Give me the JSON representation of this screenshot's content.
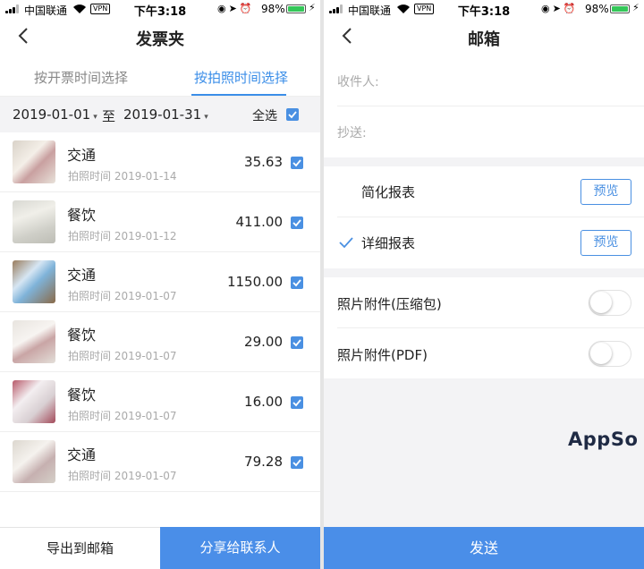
{
  "status_bar": {
    "carrier": "中国联通",
    "vpn": "VPN",
    "time": "下午3:18",
    "battery_pct": "98%",
    "battery_level": 0.98
  },
  "left": {
    "title": "发票夹",
    "tabs": [
      {
        "label": "按开票时间选择",
        "active": false
      },
      {
        "label": "按拍照时间选择",
        "active": true
      }
    ],
    "date_from": "2019-01-01",
    "date_to": "2019-01-31",
    "to_label": "至",
    "select_all": "全选",
    "items": [
      {
        "category": "交通",
        "time_label": "拍照时间 2019-01-14",
        "amount": "35.63",
        "checked": true
      },
      {
        "category": "餐饮",
        "time_label": "拍照时间 2019-01-12",
        "amount": "411.00",
        "checked": true
      },
      {
        "category": "交通",
        "time_label": "拍照时间 2019-01-07",
        "amount": "1150.00",
        "checked": true
      },
      {
        "category": "餐饮",
        "time_label": "拍照时间 2019-01-07",
        "amount": "29.00",
        "checked": true
      },
      {
        "category": "餐饮",
        "time_label": "拍照时间 2019-01-07",
        "amount": "16.00",
        "checked": true
      },
      {
        "category": "交通",
        "time_label": "拍照时间 2019-01-07",
        "amount": "79.28",
        "checked": true
      }
    ],
    "export_label": "导出到邮箱",
    "share_label": "分享给联系人"
  },
  "right": {
    "title": "邮箱",
    "recipient_label": "收件人:",
    "cc_label": "抄送:",
    "reports": [
      {
        "label": "简化报表",
        "selected": false,
        "preview": "预览"
      },
      {
        "label": "详细报表",
        "selected": true,
        "preview": "预览"
      }
    ],
    "attachments": [
      {
        "label": "照片附件(压缩包)",
        "on": false
      },
      {
        "label": "照片附件(PDF)",
        "on": false
      }
    ],
    "watermark": "AppSo",
    "send_label": "发送"
  },
  "colors": {
    "accent": "#4a8ee8",
    "tab_active": "#3b8ee8",
    "muted": "#aaaaaa",
    "gray_bg": "#f3f3f5",
    "battery": "#34c759"
  },
  "icons": [
    "signal-icon",
    "wifi-icon",
    "back-chevron-icon",
    "checkbox-icon",
    "checkmark-icon",
    "lock-rotation-icon",
    "location-icon",
    "alarm-icon",
    "battery-icon",
    "charging-icon"
  ]
}
